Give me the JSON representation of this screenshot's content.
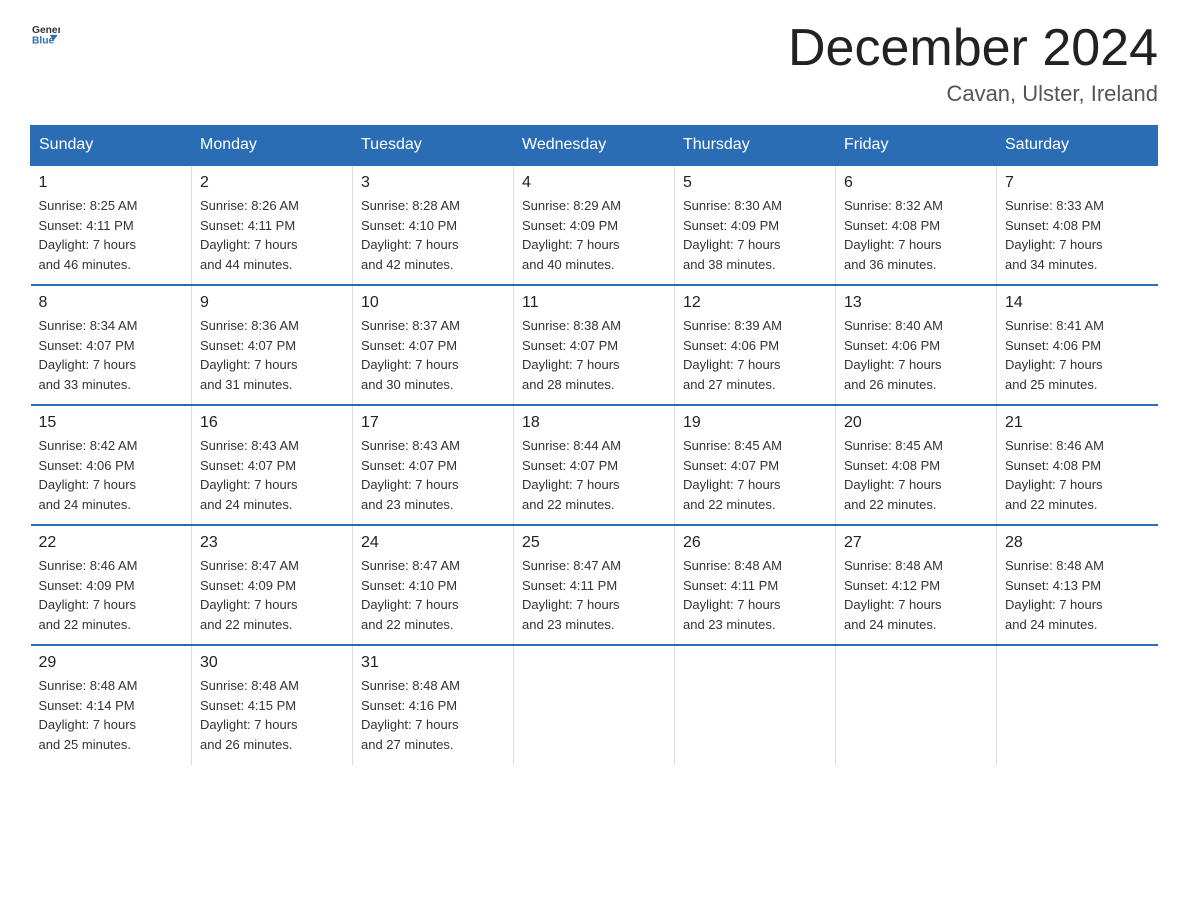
{
  "header": {
    "logo_text_general": "General",
    "logo_text_blue": "Blue",
    "month_title": "December 2024",
    "location": "Cavan, Ulster, Ireland"
  },
  "days_of_week": [
    "Sunday",
    "Monday",
    "Tuesday",
    "Wednesday",
    "Thursday",
    "Friday",
    "Saturday"
  ],
  "weeks": [
    [
      {
        "day": "1",
        "sunrise": "8:25 AM",
        "sunset": "4:11 PM",
        "daylight": "7 hours and 46 minutes."
      },
      {
        "day": "2",
        "sunrise": "8:26 AM",
        "sunset": "4:11 PM",
        "daylight": "7 hours and 44 minutes."
      },
      {
        "day": "3",
        "sunrise": "8:28 AM",
        "sunset": "4:10 PM",
        "daylight": "7 hours and 42 minutes."
      },
      {
        "day": "4",
        "sunrise": "8:29 AM",
        "sunset": "4:09 PM",
        "daylight": "7 hours and 40 minutes."
      },
      {
        "day": "5",
        "sunrise": "8:30 AM",
        "sunset": "4:09 PM",
        "daylight": "7 hours and 38 minutes."
      },
      {
        "day": "6",
        "sunrise": "8:32 AM",
        "sunset": "4:08 PM",
        "daylight": "7 hours and 36 minutes."
      },
      {
        "day": "7",
        "sunrise": "8:33 AM",
        "sunset": "4:08 PM",
        "daylight": "7 hours and 34 minutes."
      }
    ],
    [
      {
        "day": "8",
        "sunrise": "8:34 AM",
        "sunset": "4:07 PM",
        "daylight": "7 hours and 33 minutes."
      },
      {
        "day": "9",
        "sunrise": "8:36 AM",
        "sunset": "4:07 PM",
        "daylight": "7 hours and 31 minutes."
      },
      {
        "day": "10",
        "sunrise": "8:37 AM",
        "sunset": "4:07 PM",
        "daylight": "7 hours and 30 minutes."
      },
      {
        "day": "11",
        "sunrise": "8:38 AM",
        "sunset": "4:07 PM",
        "daylight": "7 hours and 28 minutes."
      },
      {
        "day": "12",
        "sunrise": "8:39 AM",
        "sunset": "4:06 PM",
        "daylight": "7 hours and 27 minutes."
      },
      {
        "day": "13",
        "sunrise": "8:40 AM",
        "sunset": "4:06 PM",
        "daylight": "7 hours and 26 minutes."
      },
      {
        "day": "14",
        "sunrise": "8:41 AM",
        "sunset": "4:06 PM",
        "daylight": "7 hours and 25 minutes."
      }
    ],
    [
      {
        "day": "15",
        "sunrise": "8:42 AM",
        "sunset": "4:06 PM",
        "daylight": "7 hours and 24 minutes."
      },
      {
        "day": "16",
        "sunrise": "8:43 AM",
        "sunset": "4:07 PM",
        "daylight": "7 hours and 24 minutes."
      },
      {
        "day": "17",
        "sunrise": "8:43 AM",
        "sunset": "4:07 PM",
        "daylight": "7 hours and 23 minutes."
      },
      {
        "day": "18",
        "sunrise": "8:44 AM",
        "sunset": "4:07 PM",
        "daylight": "7 hours and 22 minutes."
      },
      {
        "day": "19",
        "sunrise": "8:45 AM",
        "sunset": "4:07 PM",
        "daylight": "7 hours and 22 minutes."
      },
      {
        "day": "20",
        "sunrise": "8:45 AM",
        "sunset": "4:08 PM",
        "daylight": "7 hours and 22 minutes."
      },
      {
        "day": "21",
        "sunrise": "8:46 AM",
        "sunset": "4:08 PM",
        "daylight": "7 hours and 22 minutes."
      }
    ],
    [
      {
        "day": "22",
        "sunrise": "8:46 AM",
        "sunset": "4:09 PM",
        "daylight": "7 hours and 22 minutes."
      },
      {
        "day": "23",
        "sunrise": "8:47 AM",
        "sunset": "4:09 PM",
        "daylight": "7 hours and 22 minutes."
      },
      {
        "day": "24",
        "sunrise": "8:47 AM",
        "sunset": "4:10 PM",
        "daylight": "7 hours and 22 minutes."
      },
      {
        "day": "25",
        "sunrise": "8:47 AM",
        "sunset": "4:11 PM",
        "daylight": "7 hours and 23 minutes."
      },
      {
        "day": "26",
        "sunrise": "8:48 AM",
        "sunset": "4:11 PM",
        "daylight": "7 hours and 23 minutes."
      },
      {
        "day": "27",
        "sunrise": "8:48 AM",
        "sunset": "4:12 PM",
        "daylight": "7 hours and 24 minutes."
      },
      {
        "day": "28",
        "sunrise": "8:48 AM",
        "sunset": "4:13 PM",
        "daylight": "7 hours and 24 minutes."
      }
    ],
    [
      {
        "day": "29",
        "sunrise": "8:48 AM",
        "sunset": "4:14 PM",
        "daylight": "7 hours and 25 minutes."
      },
      {
        "day": "30",
        "sunrise": "8:48 AM",
        "sunset": "4:15 PM",
        "daylight": "7 hours and 26 minutes."
      },
      {
        "day": "31",
        "sunrise": "8:48 AM",
        "sunset": "4:16 PM",
        "daylight": "7 hours and 27 minutes."
      },
      null,
      null,
      null,
      null
    ]
  ],
  "labels": {
    "sunrise": "Sunrise:",
    "sunset": "Sunset:",
    "daylight": "Daylight:"
  }
}
